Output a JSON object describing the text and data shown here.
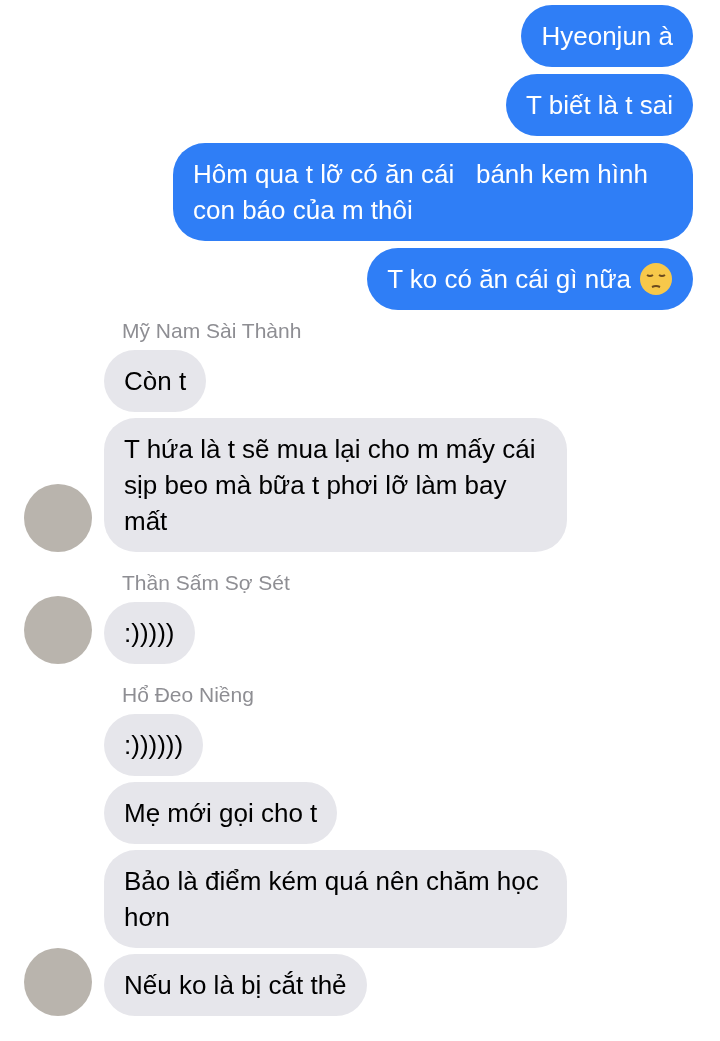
{
  "groups": [
    {
      "kind": "outgoing",
      "messages": [
        {
          "kind": "text",
          "text": "Hyeonjun à"
        },
        {
          "kind": "text",
          "text": "T biết là t sai"
        },
        {
          "kind": "text",
          "text": "Hôm qua t lỡ có ăn cái   bánh kem hình con báo của m thôi"
        },
        {
          "kind": "emoji_text",
          "text": "T ko có ăn cái gì nữa"
        }
      ]
    },
    {
      "kind": "incoming",
      "sender": "Mỹ Nam Sài Thành",
      "messages": [
        {
          "kind": "text",
          "text": "Còn t"
        },
        {
          "kind": "text",
          "text": "T hứa là t sẽ mua lại cho m mấy cái sịp beo mà bữa t phơi lỡ làm bay mất"
        }
      ]
    },
    {
      "kind": "incoming",
      "sender": "Thần Sấm Sợ Sét",
      "messages": [
        {
          "kind": "text",
          "text": ":)))))"
        }
      ]
    },
    {
      "kind": "incoming",
      "sender": "Hổ Đeo Niềng",
      "messages": [
        {
          "kind": "text",
          "text": ":))))))"
        },
        {
          "kind": "text",
          "text": "Mẹ mới gọi cho t"
        },
        {
          "kind": "text",
          "text": "Bảo là điểm kém quá nên chăm học hơn"
        },
        {
          "kind": "text",
          "text": "Nếu ko là bị cắt thẻ"
        }
      ]
    }
  ]
}
